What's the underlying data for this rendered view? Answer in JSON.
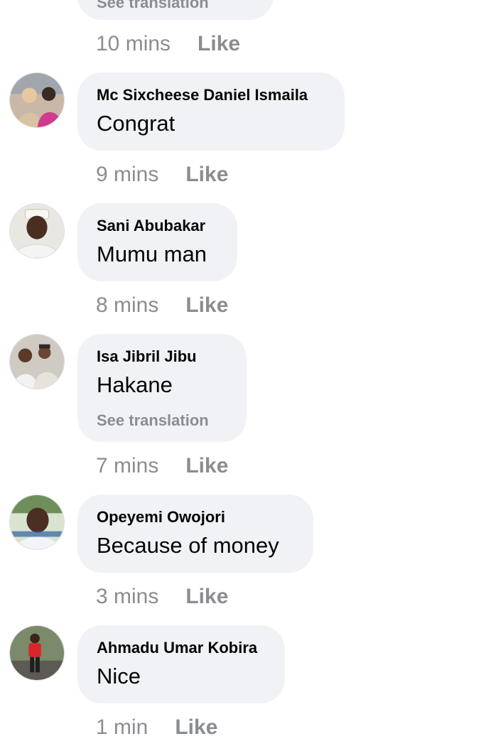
{
  "like_label": "Like",
  "top_comment": {
    "see_translation": "See translation",
    "time": "10 mins"
  },
  "comments": [
    {
      "author": "Mc Sixcheese Daniel Ismaila",
      "text": "Congrat",
      "time": "9 mins"
    },
    {
      "author": "Sani Abubakar",
      "text": "Mumu man",
      "time": "8 mins"
    },
    {
      "author": "Isa Jibril Jibu",
      "text": "Hakane",
      "see_translation": "See translation",
      "time": "7 mins"
    },
    {
      "author": "Opeyemi Owojori",
      "text": "Because of money",
      "time": "3 mins"
    },
    {
      "author": "Ahmadu Umar Kobira",
      "text": "Nice",
      "time": "1 min"
    }
  ]
}
